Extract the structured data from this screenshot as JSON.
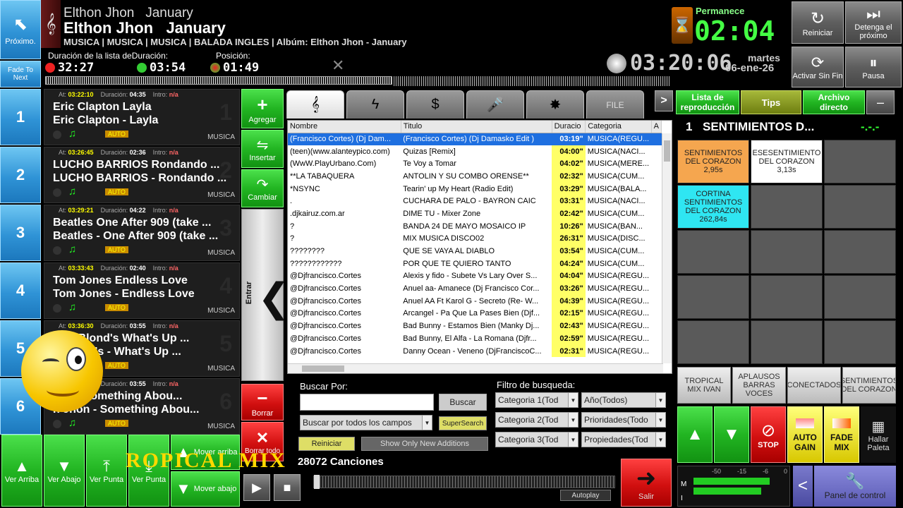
{
  "next_button": {
    "label": "Próximo."
  },
  "fade_button": {
    "label": "Fade To Next"
  },
  "now_playing": {
    "artist1": "Elthon Jhon",
    "title1": "January",
    "artist2": "Elthon Jhon",
    "title2": "January",
    "meta": "MUSICA | MUSICA | MUSICA | BALADA INGLES | Albúm: Elthon Jhon - January"
  },
  "timers": {
    "list_label": "Duración de la lista de",
    "duration_label": "Duración:",
    "position_label": "Posición:",
    "list_value": "32:27",
    "duration_value": "03:54",
    "position_value": "01:49"
  },
  "remain": {
    "label": "Permanece",
    "value": "02:04"
  },
  "clock": {
    "time": "03:20:06",
    "day": "martes",
    "date": "06-ene-26"
  },
  "top_buttons": {
    "restart": "Reiniciar",
    "stop_next": "Detenga el próximo",
    "activate": "Activar Sin Fin",
    "pause": "Pausa"
  },
  "queue": [
    {
      "num": "1",
      "at": "03:22:10",
      "dur": "04:35",
      "intro": "n/a",
      "line1": "Eric Clapton   Layla",
      "line2": "Eric Clapton - Layla",
      "auto": "AUTO",
      "cat": "MUSICA"
    },
    {
      "num": "2",
      "at": "03:26:45",
      "dur": "02:36",
      "intro": "n/a",
      "line1": "LUCHO BARRIOS   Rondando ...",
      "line2": "LUCHO BARRIOS - Rondando ...",
      "auto": "AUTO",
      "cat": "MUSICA"
    },
    {
      "num": "3",
      "at": "03:29:21",
      "dur": "04:22",
      "intro": "n/a",
      "line1": "Beatles   One After 909 (take ...",
      "line2": "Beatles - One After 909 (take ...",
      "auto": "AUTO",
      "cat": "MUSICA"
    },
    {
      "num": "4",
      "at": "03:33:43",
      "dur": "02:40",
      "intro": "n/a",
      "line1": "Tom Jones   Endless Love",
      "line2": "Tom Jones - Endless Love",
      "auto": "AUTO",
      "cat": "MUSICA"
    },
    {
      "num": "5",
      "at": "03:36:30",
      "dur": "03:55",
      "intro": "n/a",
      "line1": "Non Blond's   What's Up ...",
      "line2": "n Blond's - What's Up ...",
      "auto": "AUTO",
      "cat": "MUSICA"
    },
    {
      "num": "6",
      "at": "03:40:25",
      "dur": "03:55",
      "intro": "n/a",
      "line1": "Jhon   Something Abou...",
      "line2": "n Jhon - Something Abou...",
      "auto": "AUTO",
      "cat": "MUSICA"
    }
  ],
  "queue_labels": {
    "at": "At:",
    "dur": "Duración:",
    "intro": "Intro:"
  },
  "side_buttons": {
    "add": "Agregar",
    "insert": "Insertar",
    "change": "Cambiar",
    "enter": "Entrar",
    "delete": "Borrar",
    "delete_all": "Borrar todo",
    "exit": "Salir"
  },
  "bottom_left": {
    "up": "Ver Arriba",
    "down": "Ver Abajo",
    "top": "Ver Punta",
    "point": "Ver Punta",
    "move_up": "Mover arriba",
    "move_down": "Mover abajo"
  },
  "tabs": {
    "file": "FILE",
    "arrow": ">"
  },
  "table": {
    "headers": [
      "Nombre",
      "Titulo",
      "Duracio",
      "Categoria",
      "A"
    ],
    "rows": [
      [
        "(Francisco Cortes) (Dj Dam...",
        "(Francisco Cortes) (Dj Damasko Edit )",
        "03:19\"",
        "MUSICA(REGU..."
      ],
      [
        "(teen)(www.alanteypico.com)",
        "Quizas [Remix]",
        "04:00\"",
        "MUSICA(NACI..."
      ],
      [
        "(WwW.PlayUrbano.Com)",
        "Te Voy a Tomar",
        "04:02\"",
        "MUSICA(MERE..."
      ],
      [
        "**LA TABAQUERA",
        "ANTOLIN Y SU COMBO ORENSE**",
        "02:32\"",
        "MUSICA(CUM..."
      ],
      [
        "*NSYNC",
        "Tearin' up My Heart (Radio Edit)",
        "03:29\"",
        "MUSICA(BALA..."
      ],
      [
        ".",
        "CUCHARA DE PALO - BAYRON CAIC",
        "03:31\"",
        "MUSICA(NACI..."
      ],
      [
        ".djkairuz.com.ar",
        "DIME TU - Mixer Zone",
        "02:42\"",
        "MUSICA(CUM..."
      ],
      [
        "?",
        "BANDA 24 DE MAYO MOSAICO IP",
        "10:26\"",
        "MUSICA(BAN..."
      ],
      [
        "?",
        "MIX MUSICA DISCO02",
        "26:31\"",
        "MUSICA(DISC..."
      ],
      [
        "????????",
        "QUE SE VAYA AL DIABLO",
        "03:54\"",
        "MUSICA(CUM..."
      ],
      [
        "????????????",
        "POR QUE TE QUIERO TANTO",
        "04:24\"",
        "MUSICA(CUM..."
      ],
      [
        "@Djfrancisco.Cortes",
        "Alexis y fido - Subete Vs Lary Over S...",
        "04:04\"",
        "MUSICA(REGU..."
      ],
      [
        "@Djfrancisco.Cortes",
        "Anuel aa- Amanece (Dj Francisco Cor...",
        "03:26\"",
        "MUSICA(REGU..."
      ],
      [
        "@Djfrancisco.Cortes",
        "Anuel AA Ft Karol G - Secreto (Re- W...",
        "04:39\"",
        "MUSICA(REGU..."
      ],
      [
        "@Djfrancisco.Cortes",
        "Arcangel - Pa Que La Pases Bien (Djf...",
        "02:15\"",
        "MUSICA(REGU..."
      ],
      [
        "@Djfrancisco.Cortes",
        "Bad Bunny - Estamos Bien (Manky Dj...",
        "02:43\"",
        "MUSICA(REGU..."
      ],
      [
        "@Djfrancisco.Cortes",
        "Bad Bunny, El Alfa - La Romana (Djfr...",
        "02:59\"",
        "MUSICA(REGU..."
      ],
      [
        "@Djfrancisco.Cortes",
        "Danny Ocean - Veneno (DjFranciscoC...",
        "02:31\"",
        "MUSICA(REGU..."
      ]
    ]
  },
  "search": {
    "label": "Buscar Por:",
    "button": "Buscar",
    "scope": "Buscar por todos los campos",
    "supersearch": "SuperSearch",
    "reset": "Reiniciar",
    "show_new": "Show Only New Additions",
    "filter_label": "Filtro de busqueda:",
    "cat1": "Categoria 1(Tod",
    "cat2": "Categoria 2(Tod",
    "cat3": "Categoria 3(Tod",
    "year": "Año(Todos)",
    "prio": "Prioridades(Todo",
    "props": "Propiedades(Tod"
  },
  "footer": {
    "count": "28072 Canciones",
    "marquee": "ROPICAL  MIX",
    "autoplay": "Autoplay"
  },
  "right_top": {
    "playlist": "Lista de reproducción",
    "tips": "Tips",
    "archive": "Archivo directo",
    "minus": "–"
  },
  "cart_header": {
    "num": "1",
    "title": "SENTIMIENTOS D...",
    "indicator": "-.-.-"
  },
  "carts": [
    {
      "l1": "SENTIMIENTOS",
      "l2": "DEL CORAZON",
      "l3": "2,95s"
    },
    {
      "l1": "ESESENTIMIENTO",
      "l2": "DEL CORAZON",
      "l3": "3,13s"
    },
    {
      "l1": "CORTINA",
      "l2": "SENTIMIENTOS DEL CORAZON",
      "l3": "262,84s"
    }
  ],
  "cart_tabs": [
    "TROPICAL MIX IVAN",
    "APLAUSOS BARRAS VOCES",
    "CONECTADOS",
    "SENTIMIENTOS DEL CORAZON"
  ],
  "right_bottom": {
    "stop": "STOP",
    "autogain": "AUTO GAIN",
    "fademix": "FADE MIX",
    "palette": "Hallar Paleta",
    "control": "Panel de control",
    "back": "<"
  },
  "meter": {
    "ticks": [
      "-50",
      "-15",
      "-6",
      "0"
    ],
    "m": "M",
    "i": "I"
  }
}
